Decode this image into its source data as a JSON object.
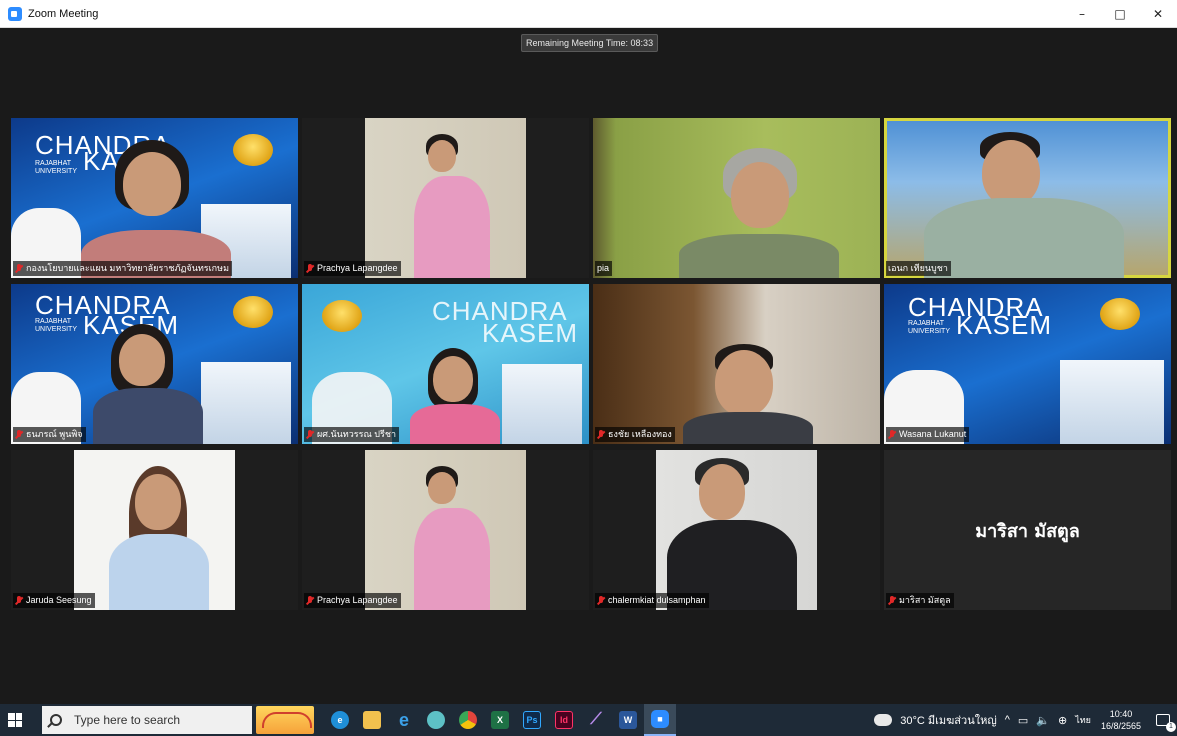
{
  "window": {
    "title": "Zoom Meeting",
    "controls": {
      "minimize": "–",
      "maximize": "□",
      "close": "✕"
    }
  },
  "meeting": {
    "remaining_time": "Remaining Meeting Time: 08:33",
    "participants": [
      {
        "name": "กองนโยบายและแผน มหาวิทยาลัยราชภัฏจันทรเกษม",
        "muted": true
      },
      {
        "name": "Prachya Lapangdee",
        "muted": true
      },
      {
        "name": "pia",
        "muted": false
      },
      {
        "name": "เอนก เทียนบูชา",
        "muted": false,
        "active_speaker": true
      },
      {
        "name": "ธนภรณ์ พูนพิจ",
        "muted": true
      },
      {
        "name": "ผศ.นันทวรรณ ปรีชา",
        "muted": true
      },
      {
        "name": "ธงชัย เหลืองทอง",
        "muted": true
      },
      {
        "name": "Wasana Lukanut",
        "muted": true
      },
      {
        "name": "Jaruda Seesung",
        "muted": true
      },
      {
        "name": "Prachya Lapangdee",
        "muted": true
      },
      {
        "name": "chalermkiat dulsamphan",
        "muted": true
      },
      {
        "name": "มาริสา มัสตูล",
        "muted": true,
        "video_off": true,
        "display_text": "มาริสา มัสตูล"
      }
    ],
    "branding": {
      "logo_main": "CHANDRA",
      "logo_second": "KASEM",
      "logo_sub_1": "RAJABHAT",
      "logo_sub_2": "UNIVERSITY"
    }
  },
  "taskbar": {
    "search_placeholder": "Type here to search",
    "apps": [
      {
        "icon": "edge-icon",
        "label": "e",
        "color": "#1f8fd8"
      },
      {
        "icon": "file-explorer-icon",
        "label": "",
        "color": "#f2c14e"
      },
      {
        "icon": "internet-explorer-icon",
        "label": "e",
        "color": "#3ba0e8"
      },
      {
        "icon": "paint-icon",
        "label": "",
        "color": "#5dc1c6"
      },
      {
        "icon": "chrome-icon",
        "label": "",
        "color": "#e2453c"
      },
      {
        "icon": "excel-icon",
        "label": "X",
        "color": "#1e7145"
      },
      {
        "icon": "photoshop-icon",
        "label": "Ps",
        "color": "#0f2a4a"
      },
      {
        "icon": "indesign-icon",
        "label": "Id",
        "color": "#49021f"
      },
      {
        "icon": "quill-icon",
        "label": "",
        "color": "#9a6bd6"
      },
      {
        "icon": "word-icon",
        "label": "W",
        "color": "#2b579a"
      },
      {
        "icon": "zoom-icon",
        "label": "",
        "color": "#2d8cff"
      }
    ],
    "weather": "30°C มีเมฆส่วนใหญ่",
    "language": "ไทย",
    "time": "10:40",
    "date": "16/8/2565"
  }
}
